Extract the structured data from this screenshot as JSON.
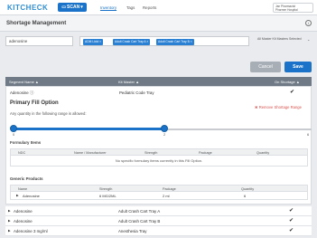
{
  "header": {
    "logo": "KITCHECK",
    "scan_label": "SCAN",
    "nav": [
      "Inventory",
      "Tags",
      "Reports"
    ],
    "user_line1": "Jan Pharmacist",
    "user_line2": "Pharmer Hospital"
  },
  "page": {
    "title": "Shortage Management",
    "info": "i"
  },
  "filters": {
    "search_value": "adenosine",
    "chips": [
      "ADM Lidol",
      "Adult Crash Cart Tray A",
      "Adult Crash Cart Tray B"
    ],
    "chip_close": "×",
    "master_select": "All Master Kit Masters Selected",
    "chevron": "⌄"
  },
  "actions": {
    "cancel": "Cancel",
    "save": "Save"
  },
  "table": {
    "columns": [
      "Segment Name",
      "Kit Master",
      "On Shortage"
    ],
    "sort_arrows": [
      "▲",
      "▲",
      "▲"
    ],
    "expanded_row": {
      "segment": "Adenosine",
      "kit_master": "Pediatric Code Tray",
      "check": "✔"
    },
    "fill_option_title": "Primary Fill Option",
    "fill_option_desc": "Any quantity in the following range is allowed:",
    "remove_label": "Remove Shortage Range",
    "remove_icon": "✖",
    "slider": {
      "min": "0",
      "mid": "2",
      "max": "6",
      "value": 2,
      "range_max": 6
    },
    "formulary_title": "Formulary Items",
    "formulary_columns": [
      "NDC",
      "Name / Manufacturer",
      "Strength",
      "Package",
      "Quantity"
    ],
    "formulary_empty": "No specific formulary items currently in this Fill Option.",
    "generic_title": "Generic Products",
    "generic_columns": [
      "Name",
      "Strength",
      "Package",
      "Quantity"
    ],
    "generic_row": {
      "name": "Adenosine",
      "strength": "6 MG/2ML",
      "package": "2 ml",
      "quantity": "6"
    }
  },
  "list_rows": [
    {
      "segment": "Adenosine",
      "kit_master": "Adult Crash Cart Tray A",
      "check": "✔"
    },
    {
      "segment": "Adenosine",
      "kit_master": "Adult Crash Cart Tray B",
      "check": "✔"
    },
    {
      "segment": "Adenosine 3 mg/ml",
      "kit_master": "Anesthesia Tray",
      "check": "✔"
    }
  ],
  "colors": {
    "accent": "#1a73c8",
    "header_bg": "#6f7a86",
    "remove": "#d9544f"
  }
}
